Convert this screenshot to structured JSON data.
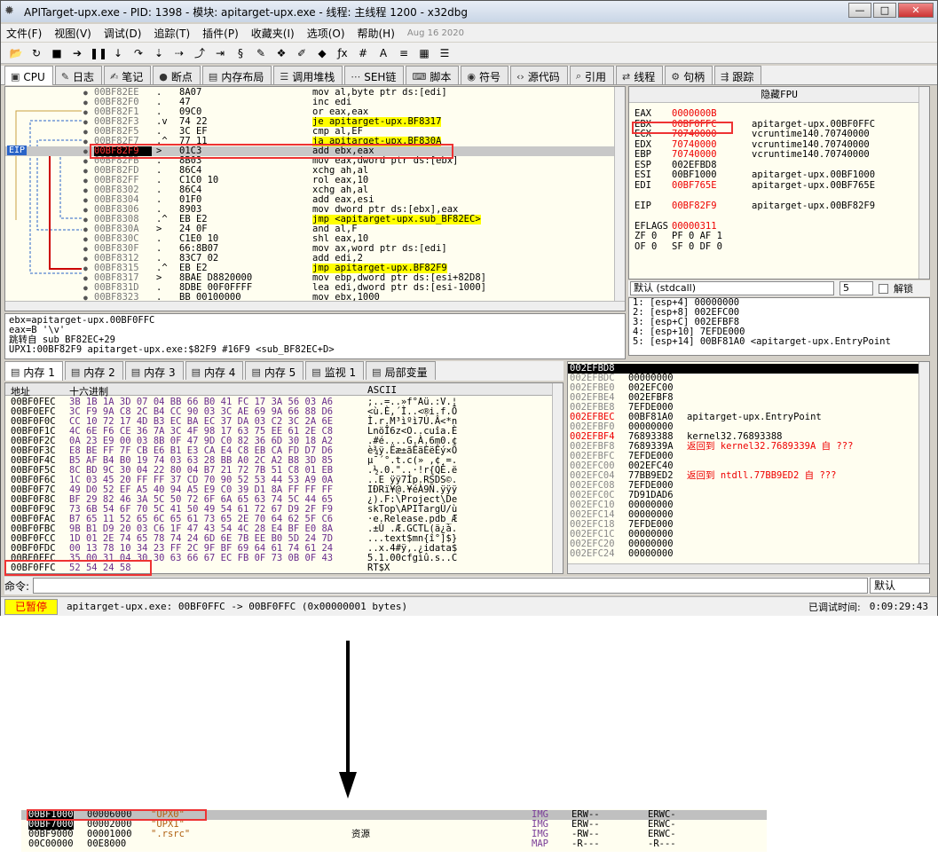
{
  "window": {
    "title": "APITarget-upx.exe - PID: 1398 - 模块: apitarget-upx.exe - 线程: 主线程 1200 - x32dbg",
    "btn_min": "—",
    "btn_max": "□",
    "btn_close": "✕"
  },
  "menu": [
    "文件(F)",
    "视图(V)",
    "调试(D)",
    "追踪(T)",
    "插件(P)",
    "收藏夹(I)",
    "选项(O)",
    "帮助(H)"
  ],
  "menu_date": "Aug 16 2020",
  "toolbar_icons": [
    "folder-open-icon",
    "restart-icon",
    "stop-icon",
    "run-icon",
    "pause-icon",
    "step-into-icon",
    "step-over-icon",
    "trace-into-icon",
    "trace-over-icon",
    "execute-till-return-icon",
    "run-to-user-icon",
    "script-icon",
    "patch-icon",
    "bookmark-icon",
    "comment-icon",
    "label-icon",
    "function-icon",
    "hash-icon",
    "font-icon",
    "strings-icon",
    "calculator-icon",
    "menu-icon"
  ],
  "tabs": [
    {
      "label": "CPU",
      "icon": "cpu-icon"
    },
    {
      "label": "日志",
      "icon": "log-icon"
    },
    {
      "label": "笔记",
      "icon": "notes-icon"
    },
    {
      "label": "断点",
      "icon": "breakpoint-icon"
    },
    {
      "label": "内存布局",
      "icon": "memory-map-icon"
    },
    {
      "label": "调用堆栈",
      "icon": "call-stack-icon"
    },
    {
      "label": "SEH链",
      "icon": "seh-icon"
    },
    {
      "label": "脚本",
      "icon": "script-tab-icon"
    },
    {
      "label": "符号",
      "icon": "symbol-icon"
    },
    {
      "label": "源代码",
      "icon": "source-icon"
    },
    {
      "label": "引用",
      "icon": "references-icon"
    },
    {
      "label": "线程",
      "icon": "threads-icon"
    },
    {
      "label": "句柄",
      "icon": "handles-icon"
    },
    {
      "label": "跟踪",
      "icon": "trace-icon"
    }
  ],
  "disasm": [
    {
      "addr": "00BF82EE",
      "mk": ".",
      "bytes": "8A07",
      "ins": "mov al,byte ptr ds:[edi]"
    },
    {
      "addr": "00BF82F0",
      "mk": ".",
      "bytes": "47",
      "ins": "inc edi"
    },
    {
      "addr": "00BF82F1",
      "mk": ".",
      "bytes": "09C0",
      "ins": "or eax,eax"
    },
    {
      "addr": "00BF82F3",
      "mk": ".v",
      "bytes": "74 22",
      "ins": "je apitarget-upx.BF8317",
      "hl": true
    },
    {
      "addr": "00BF82F5",
      "mk": ".",
      "bytes": "3C EF",
      "ins": "cmp al,EF"
    },
    {
      "addr": "00BF82F7",
      "mk": ".^",
      "bytes": "77 11",
      "ins": "ja apitarget-upx.BF830A",
      "hl": true
    },
    {
      "addr": "00BF82F9",
      "mk": ">",
      "bytes": "01C3",
      "ins": "add ebx,eax",
      "eip": true
    },
    {
      "addr": "00BF82FB",
      "mk": ".",
      "bytes": "8B03",
      "ins": "mov eax,dword ptr ds:[ebx]"
    },
    {
      "addr": "00BF82FD",
      "mk": ".",
      "bytes": "86C4",
      "ins": "xchg ah,al"
    },
    {
      "addr": "00BF82FF",
      "mk": ".",
      "bytes": "C1C0 10",
      "ins": "rol eax,10"
    },
    {
      "addr": "00BF8302",
      "mk": ".",
      "bytes": "86C4",
      "ins": "xchg ah,al"
    },
    {
      "addr": "00BF8304",
      "mk": ".",
      "bytes": "01F0",
      "ins": "add eax,esi"
    },
    {
      "addr": "00BF8306",
      "mk": ".",
      "bytes": "8903",
      "ins": "mov dword ptr ds:[ebx],eax"
    },
    {
      "addr": "00BF8308",
      "mk": ".^",
      "bytes": "EB E2",
      "ins": "jmp <apitarget-upx.sub_BF82EC>",
      "hl": true
    },
    {
      "addr": "00BF830A",
      "mk": ">",
      "bytes": "24 0F",
      "ins": "and al,F"
    },
    {
      "addr": "00BF830C",
      "mk": ".",
      "bytes": "C1E0 10",
      "ins": "shl eax,10"
    },
    {
      "addr": "00BF830F",
      "mk": ".",
      "bytes": "66:8B07",
      "ins": "mov ax,word ptr ds:[edi]"
    },
    {
      "addr": "00BF8312",
      "mk": ".",
      "bytes": "83C7 02",
      "ins": "add edi,2"
    },
    {
      "addr": "00BF8315",
      "mk": ".^",
      "bytes": "EB E2",
      "ins": "jmp apitarget-upx.BF82F9",
      "hl": true
    },
    {
      "addr": "00BF8317",
      "mk": ">",
      "bytes": "8BAE D8820000",
      "ins": "mov ebp,dword ptr ds:[esi+82D8]"
    },
    {
      "addr": "00BF831D",
      "mk": ".",
      "bytes": "8DBE 00F0FFFF",
      "ins": "lea edi,dword ptr ds:[esi-1000]"
    },
    {
      "addr": "00BF8323",
      "mk": ".",
      "bytes": "BB 00100000",
      "ins": "mov ebx,1000"
    }
  ],
  "eip_label": "EIP",
  "fpu_toggle": "隐藏FPU",
  "registers": [
    {
      "n": "EAX",
      "v": "0000000B",
      "c": "",
      "red": true
    },
    {
      "n": "EBX",
      "v": "00BF0FFC",
      "c": "apitarget-upx.00BF0FFC",
      "red": true
    },
    {
      "n": "ECX",
      "v": "70740000",
      "c": "vcruntime140.70740000",
      "red": true
    },
    {
      "n": "EDX",
      "v": "70740000",
      "c": "vcruntime140.70740000",
      "red": true
    },
    {
      "n": "EBP",
      "v": "70740000",
      "c": "vcruntime140.70740000",
      "red": true
    },
    {
      "n": "ESP",
      "v": "002EFBD8",
      "c": "",
      "red": false
    },
    {
      "n": "ESI",
      "v": "00BF1000",
      "c": "apitarget-upx.00BF1000",
      "red": false
    },
    {
      "n": "EDI",
      "v": "00BF765E",
      "c": "apitarget-upx.00BF765E",
      "red": true
    },
    {
      "n": "",
      "v": "",
      "c": "",
      "red": false
    },
    {
      "n": "EIP",
      "v": "00BF82F9",
      "c": "apitarget-upx.00BF82F9",
      "red": true
    },
    {
      "n": "",
      "v": "",
      "c": "",
      "red": false
    },
    {
      "n": "EFLAGS",
      "v": "00000311",
      "c": "",
      "red": true
    },
    {
      "n": "ZF 0",
      "v": "PF 0   AF 1",
      "c": "",
      "red": false
    },
    {
      "n": "OF 0",
      "v": "SF 0   DF 0",
      "c": "",
      "red": false
    }
  ],
  "callconv": {
    "value": "默认 (stdcall)",
    "count": "5",
    "lock_label": "解锁"
  },
  "stack_args": [
    "1: [esp+4] 00000000",
    "2: [esp+8] 002EFC00",
    "3: [esp+C] 002EFBF8",
    "4: [esp+10] 7EFDE000",
    "5: [esp+14] 00BF81A0 <apitarget-upx.EntryPoint"
  ],
  "info_lines": [
    "ebx=apitarget-upx.00BF0FFC",
    "eax=B '\\v'",
    "跳转自 sub_BF82EC+29",
    "UPX1:00BF82F9 apitarget-upx.exe:$82F9 #16F9 <sub_BF82EC+D>"
  ],
  "mem_tabs": [
    "内存 1",
    "内存 2",
    "内存 3",
    "内存 4",
    "内存 5",
    "监视 1",
    "局部变量"
  ],
  "dump_headers": {
    "addr": "地址",
    "hex": "十六进制",
    "ascii": "ASCII"
  },
  "dump": [
    {
      "a": "00BF0FEC",
      "h": "3B 1B 1A 3D 07 04 BB 66 B0 41 FC 17 3A 56 03 A6",
      "x": ";..=..»f°Aü.:V.¦"
    },
    {
      "a": "00BF0EFC",
      "h": "3C F9 9A C8 2C B4 CC 90 03 3C AE 69 9A 66 88 D6",
      "x": "<ù.È,´Ì..<®i.f.Ö"
    },
    {
      "a": "00BF0F0C",
      "h": "CC 10 72 17 4D B3 EC BA EC 37 DA 03 C2 3C 2A 6E",
      "x": "Ì.r.M³ìºì7Ú.Â<*n"
    },
    {
      "a": "00BF0F1C",
      "h": "4C 6E F6 CE 36 7A 3C 4F 98 17 63 75 EE 61 2E C8",
      "x": "LnöÎ6z<O..cuîa.È"
    },
    {
      "a": "00BF0F2C",
      "h": "0A 23 E9 00 03 8B 0F 47 9D C0 82 36 6D 30 18 A2",
      "x": ".#é....G.À.6m0.¢"
    },
    {
      "a": "00BF0F3C",
      "h": "E8 BE FF 7F CB E6 B1 E3 CA E4 C8 EB CA FD D7 D6",
      "x": "è¾ÿ.Ëæ±ãÊäÈëÊý×Ö"
    },
    {
      "a": "00BF0F4C",
      "h": "B5 AF B4 B0 19 74 03 63 28 BB A0 2C A2 B8 3D 85",
      "x": "µ¯´°.t.c(» ,¢¸=."
    },
    {
      "a": "00BF0F5C",
      "h": "8C BD 9C 30 04 22 80 04 B7 21 72 7B 51 C8 01 EB",
      "x": ".½.0.\"..·!r{QÈ.ë"
    },
    {
      "a": "00BF0F6C",
      "h": "1C 03 45 20 FF FF 37 CD 70 90 52 53 44 53 A9 0A",
      "x": "..E ÿÿ7Íp.RSDS©."
    },
    {
      "a": "00BF0F7C",
      "h": "49 D0 52 EF A5 40 94 A5 E9 C0 39 D1 8A FF FF FF",
      "x": "IÐRï¥@.¥éÀ9Ñ.ÿÿÿ"
    },
    {
      "a": "00BF0F8C",
      "h": "BF 29 82 46 3A 5C 50 72 6F 6A 65 63 74 5C 44 65",
      "x": "¿).F:\\Project\\De"
    },
    {
      "a": "00BF0F9C",
      "h": "73 6B 54 6F 70 5C 41 50 49 54 61 72 67 D9 2F F9",
      "x": "skTop\\APITargÙ/ù"
    },
    {
      "a": "00BF0FAC",
      "h": "B7 65 11 52 65 6C 65 61 73 65 2E 70 64 62 5F C6",
      "x": "·e.Release.pdb_Æ"
    },
    {
      "a": "00BF0FBC",
      "h": "9B B1 D9 20 03 C6 1F 47 43 54 4C 28 E4 BF E0 8A",
      "x": ".±Ù .Æ.GCTL(ä¿à."
    },
    {
      "a": "00BF0FCC",
      "h": "1D 01 2E 74 65 78 74 24 6D 6E 7B EE B0 5D 24 7D",
      "x": "...text$mn{î°]$}"
    },
    {
      "a": "00BF0FDC",
      "h": "00 13 78 10 34 23 FF 2C 9F BF 69 64 61 74 61 24",
      "x": "..x.4#ÿ,.¿idata$"
    },
    {
      "a": "00BF0FEC",
      "h": "35 00 31 04 30 30 63 66 67 EC FB 0F 73 0B 0F 43",
      "x": "5.1.00cfgìû.s..C"
    },
    {
      "a": "00BF0FFC",
      "h": "52 54 24 58",
      "x": "RT$X"
    }
  ],
  "stack": [
    {
      "a": "002EFBD8",
      "v": "00000000",
      "c": ""
    },
    {
      "a": "002EFBDC",
      "v": "00000000",
      "c": ""
    },
    {
      "a": "002EFBE0",
      "v": "002EFC00",
      "c": ""
    },
    {
      "a": "002EFBE4",
      "v": "002EFBF8",
      "c": ""
    },
    {
      "a": "002EFBE8",
      "v": "7EFDE000",
      "c": ""
    },
    {
      "a": "002EFBEC",
      "v": "00BF81A0",
      "c": "apitarget-upx.EntryPoint"
    },
    {
      "a": "002EFBF0",
      "v": "00000000",
      "c": ""
    },
    {
      "a": "002EFBF4",
      "v": "76893388",
      "c": "kernel32.76893388"
    },
    {
      "a": "002EFBF8",
      "v": "7689339A",
      "c": "返回到 kernel32.7689339A 自 ???"
    },
    {
      "a": "002EFBFC",
      "v": "7EFDE000",
      "c": ""
    },
    {
      "a": "002EFC00",
      "v": "002EFC40",
      "c": ""
    },
    {
      "a": "002EFC04",
      "v": "77BB9ED2",
      "c": "返回到 ntdll.77BB9ED2 自 ???"
    },
    {
      "a": "002EFC08",
      "v": "7EFDE000",
      "c": ""
    },
    {
      "a": "002EFC0C",
      "v": "7D91DAD6",
      "c": ""
    },
    {
      "a": "002EFC10",
      "v": "00000000",
      "c": ""
    },
    {
      "a": "002EFC14",
      "v": "00000000",
      "c": ""
    },
    {
      "a": "002EFC18",
      "v": "7EFDE000",
      "c": ""
    },
    {
      "a": "002EFC1C",
      "v": "00000000",
      "c": ""
    },
    {
      "a": "002EFC20",
      "v": "00000000",
      "c": ""
    },
    {
      "a": "002EFC24",
      "v": "00000000",
      "c": ""
    }
  ],
  "cmd": {
    "label": "命令:",
    "dropdown": "默认"
  },
  "status": {
    "paused": "已暂停",
    "message": "apitarget-upx.exe: 00BF0FFC -> 00BF0FFC (0x00000001 bytes)",
    "time_label": "已调试时间:",
    "time": "0:09:29:43"
  },
  "memmap": [
    {
      "addr": "00BF1000",
      "size": "00006000",
      "name": "\"UPX0\"",
      "info": "",
      "type": "IMG",
      "prot": "ERW--",
      "init": "ERWC-"
    },
    {
      "addr": "00BF7000",
      "size": "00002000",
      "name": "\"UPX1\"",
      "info": "",
      "type": "IMG",
      "prot": "ERW--",
      "init": "ERWC-"
    },
    {
      "addr": "00BF9000",
      "size": "00001000",
      "name": "\".rsrc\"",
      "info": "资源",
      "type": "IMG",
      "prot": "-RW--",
      "init": "ERWC-"
    },
    {
      "addr": "00C00000",
      "size": "00E8000",
      "name": "",
      "info": "",
      "type": "MAP",
      "prot": "-R---",
      "init": "-R---"
    }
  ]
}
